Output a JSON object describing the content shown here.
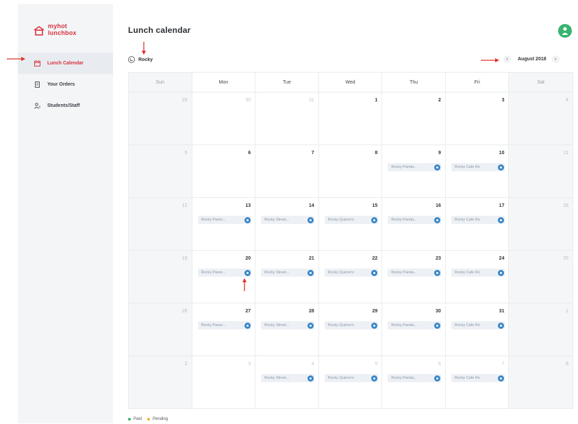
{
  "brand": {
    "line1": "myhot",
    "line2": "lunchbox",
    "color": "#d9333f"
  },
  "sidebar": {
    "items": [
      {
        "label": "Lunch Calendar",
        "icon": "calendar-icon",
        "active": true
      },
      {
        "label": "Your Orders",
        "icon": "receipt-icon",
        "active": false
      },
      {
        "label": "Students/Staff",
        "icon": "users-icon",
        "active": false
      }
    ]
  },
  "header": {
    "title": "Lunch calendar",
    "avatar_icon": "user-icon",
    "avatar_color": "#39b36f"
  },
  "child": {
    "name": "Rocky",
    "icon": "check-circle-icon"
  },
  "month": {
    "label": "August 2018",
    "prev": "‹",
    "next": "›"
  },
  "calendar": {
    "weekdays": [
      "Sun",
      "Mon",
      "Tue",
      "Wed",
      "Thu",
      "Fri",
      "Sat"
    ],
    "weeks": [
      [
        {
          "d": "29",
          "muted": true
        },
        {
          "d": "30",
          "muted": true
        },
        {
          "d": "31",
          "muted": true
        },
        {
          "d": "1"
        },
        {
          "d": "2"
        },
        {
          "d": "3"
        },
        {
          "d": "4"
        }
      ],
      [
        {
          "d": "5"
        },
        {
          "d": "6"
        },
        {
          "d": "7"
        },
        {
          "d": "8"
        },
        {
          "d": "9",
          "event": "Rocky Panda..."
        },
        {
          "d": "10",
          "event": "Rocky Cafe Ro"
        },
        {
          "d": "11"
        }
      ],
      [
        {
          "d": "12"
        },
        {
          "d": "13",
          "event": "Rocky Paner..."
        },
        {
          "d": "14",
          "event": "Rocky Street..."
        },
        {
          "d": "15",
          "event": "Rocky Quizno's"
        },
        {
          "d": "16",
          "event": "Rocky Panda..."
        },
        {
          "d": "17",
          "event": "Rocky Cafe Ro"
        },
        {
          "d": "18"
        }
      ],
      [
        {
          "d": "19"
        },
        {
          "d": "20",
          "event": "Rocky Paner..."
        },
        {
          "d": "21",
          "event": "Rocky Street..."
        },
        {
          "d": "22",
          "event": "Rocky Quizno's"
        },
        {
          "d": "23",
          "event": "Rocky Panda..."
        },
        {
          "d": "24",
          "event": "Rocky Cafe Ro"
        },
        {
          "d": "25"
        }
      ],
      [
        {
          "d": "26"
        },
        {
          "d": "27",
          "event": "Rocky Paner..."
        },
        {
          "d": "28",
          "event": "Rocky Street..."
        },
        {
          "d": "29",
          "event": "Rocky Quizno's"
        },
        {
          "d": "30",
          "event": "Rocky Panda..."
        },
        {
          "d": "31",
          "event": "Rocky Cafe Ro"
        },
        {
          "d": "1",
          "muted": true
        }
      ],
      [
        {
          "d": "2",
          "muted": true
        },
        {
          "d": "3",
          "muted": true
        },
        {
          "d": "4",
          "muted": true,
          "event": "Rocky Street..."
        },
        {
          "d": "5",
          "muted": true,
          "event": "Rocky Quizno's"
        },
        {
          "d": "6",
          "muted": true,
          "event": "Rocky Panda..."
        },
        {
          "d": "7",
          "muted": true,
          "event": "Rocky Cafe Ro"
        },
        {
          "d": "8",
          "muted": true
        }
      ]
    ]
  },
  "legend": [
    {
      "label": "Paid",
      "color": "#39b36f"
    },
    {
      "label": "Pending",
      "color": "#f2b632"
    }
  ],
  "colors": {
    "accent": "#d9333f",
    "event_badge": "#3a86c8",
    "annotation": "#e0322b"
  }
}
